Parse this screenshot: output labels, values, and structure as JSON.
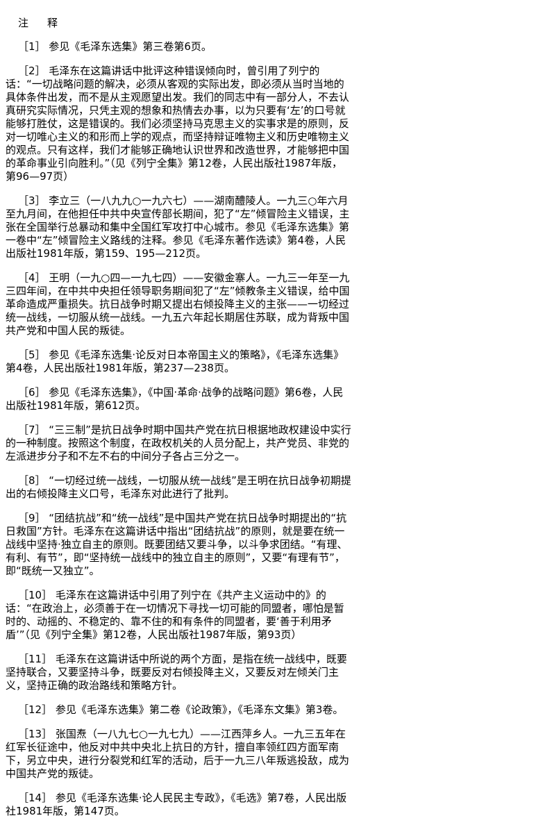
{
  "heading": "注　释",
  "notes": [
    "［1］ 参见《毛泽东选集》第三卷第6页。",
    "［2］ 毛泽东在这篇讲话中批评这种错误倾向时，曾引用了列宁的话：“一切战略问题的解决，必须从客观的实际出发，即必须从当时当地的具体条件出发，而不是从主观愿望出发。我们的同志中有一部分人，不去认真研究实际情况，只凭主观的想象和热情去办事，以为只要有‘左’的口号就能够打胜仗，这是错误的。我们必须坚持马克思主义的实事求是的原则，反对一切唯心主义的和形而上学的观点，而坚持辩证唯物主义和历史唯物主义的观点。只有这样，我们才能够正确地认识世界和改造世界，才能够把中国的革命事业引向胜利。”（见《列宁全集》第12卷，人民出版社1987年版，第96—97页）",
    "［3］ 李立三（一八九九○一九六七）——湖南醴陵人。一九三○年六月至九月间，在他担任中共中央宣传部长期间，犯了“左”倾冒险主义错误，主张在全国举行总暴动和集中全国红军攻打中心城市。参见《毛泽东选集》第一卷中“左”倾冒险主义路线的注释。参见《毛泽东著作选读》第4卷，人民出版社1981年版，第159、195—212页。",
    "［4］ 王明（一九○四—一九七四）——安徽金寨人。一九三一年至一九三四年间，在中共中央担任领导职务期间犯了“左”倾教条主义错误，给中国革命造成严重损失。抗日战争时期又提出右倾投降主义的主张——一切经过统一战线，一切服从统一战线。一九五六年起长期居住苏联，成为背叛中国共产党和中国人民的叛徒。",
    "［5］ 参见《毛泽东选集·论反对日本帝国主义的策略》，《毛泽东选集》第4卷，人民出版社1981年版，第237—238页。",
    "［6］ 参见《毛泽东选集》，《中国·革命·战争的战略问题》第6卷，人民出版社1981年版，第612页。",
    "［7］ “三三制”是抗日战争时期中国共产党在抗日根据地政权建设中实行的一种制度。按照这个制度，在政权机关的人员分配上，共产党员、非党的左派进步分子和不左不右的中间分子各占三分之一。",
    "［8］ “一切经过统一战线，一切服从统一战线”是王明在抗日战争初期提出的右倾投降主义口号，毛泽东对此进行了批判。",
    "［9］ “团结抗战”和“统一战线”是中国共产党在抗日战争时期提出的“抗日救国”方针。毛泽东在这篇讲话中指出“团结抗战”的原则，就是要在统一战线中坚持·独立自主的原则。既要团结又要斗争，以斗争求团结。“有理、有利、有节”，即“坚持统一战线中的独立自主的原则”，又要“有理有节”，即“既统一又独立”。",
    "［10］ 毛泽东在这篇讲话中引用了列宁在《共产主义运动中的》的话：“在政治上，必须善于在一切情况下寻找一切可能的同盟者，哪怕是暂时的、动摇的、不稳定的、靠不住的和有条件的同盟者，要‘善于利用矛盾’”（见《列宁全集》第12卷，人民出版社1987年版，第93页）",
    "［11］ 毛泽东在这篇讲话中所说的两个方面，是指在统一战线中，既要坚持联合，又要坚持斗争，既要反对右倾投降主义，又要反对左倾关门主义，坚持正确的政治路线和策略方针。",
    "［12］ 参见《毛泽东选集》第二卷《论政策》，《毛泽东文集》第3卷。",
    "［13］ 张国焘（一八九七○一九七九）——江西萍乡人。一九三五年在红军长征途中，他反对中共中央北上抗日的方针，擅自率领红四方面军南下，另立中央，进行分裂党和红军的活动，后于一九三八年叛逃投敌，成为中国共产党的叛徒。",
    "［14］ 参见《毛泽东选集·论人民民主专政》，《毛选》第7卷，人民出版社1981年版，第147页。"
  ]
}
